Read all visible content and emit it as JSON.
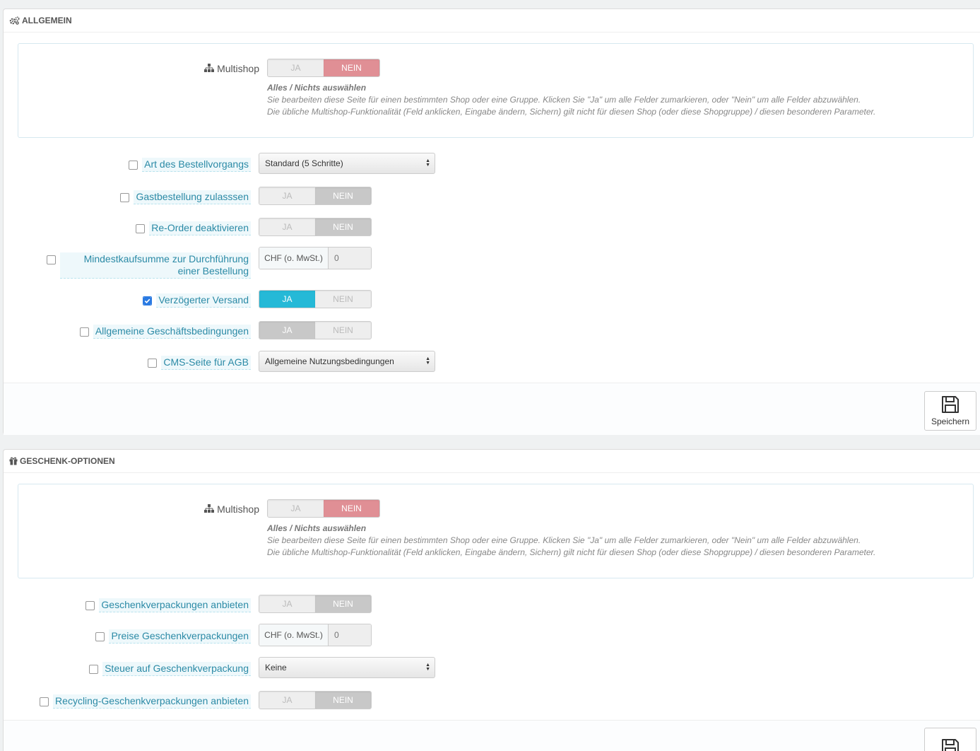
{
  "general": {
    "heading": "ALLGEMEIN",
    "multishop": {
      "label": "Multishop",
      "yes": "JA",
      "no": "NEIN",
      "help_title": "Alles / Nichts auswählen",
      "help_line1": "Sie bearbeiten diese Seite für einen bestimmten Shop oder eine Gruppe. Klicken Sie \"Ja\" um alle Felder zumarkieren, oder \"Nein\" um alle Felder abzuwählen.",
      "help_line2": "Die übliche Multishop-Funktionalität (Feld anklicken, Eingabe ändern, Sichern) gilt nicht für diesen Shop (oder diese Shopgruppe) / diesen besonderen Parameter."
    },
    "order_process": {
      "label": "Art des Bestellvorgangs",
      "value": "Standard (5 Schritte)"
    },
    "guest_checkout": {
      "label": "Gastbestellung zulasssen",
      "yes": "JA",
      "no": "NEIN"
    },
    "reorder": {
      "label": "Re-Order deaktivieren",
      "yes": "JA",
      "no": "NEIN"
    },
    "min_purchase": {
      "label": "Mindestkaufsumme zur Durchführung einer Bestellung",
      "addon": "CHF (o. MwSt.)",
      "placeholder": "0"
    },
    "delayed_shipping": {
      "label": "Verzögerter Versand",
      "yes": "JA",
      "no": "NEIN"
    },
    "terms": {
      "label": "Allgemeine Geschäftsbedingungen",
      "yes": "JA",
      "no": "NEIN"
    },
    "cms_terms": {
      "label": "CMS-Seite für AGB",
      "value": "Allgemeine Nutzungsbedingungen"
    },
    "save_label": "Speichern"
  },
  "gift": {
    "heading": "GESCHENK-OPTIONEN",
    "multishop": {
      "label": "Multishop",
      "yes": "JA",
      "no": "NEIN",
      "help_title": "Alles / Nichts auswählen",
      "help_line1": "Sie bearbeiten diese Seite für einen bestimmten Shop oder eine Gruppe. Klicken Sie \"Ja\" um alle Felder zumarkieren, oder \"Nein\" um alle Felder abzuwählen.",
      "help_line2": "Die übliche Multishop-Funktionalität (Feld anklicken, Eingabe ändern, Sichern) gilt nicht für diesen Shop (oder diese Shopgruppe) / diesen besonderen Parameter."
    },
    "gift_wrapping": {
      "label": "Geschenkverpackungen anbieten",
      "yes": "JA",
      "no": "NEIN"
    },
    "gift_price": {
      "label": "Preise Geschenkverpackungen",
      "addon": "CHF (o. MwSt.)",
      "placeholder": "0"
    },
    "gift_tax": {
      "label": "Steuer auf Geschenkverpackung",
      "value": "Keine"
    },
    "recycling": {
      "label": "Recycling-Geschenkverpackungen anbieten",
      "yes": "JA",
      "no": "NEIN"
    }
  }
}
